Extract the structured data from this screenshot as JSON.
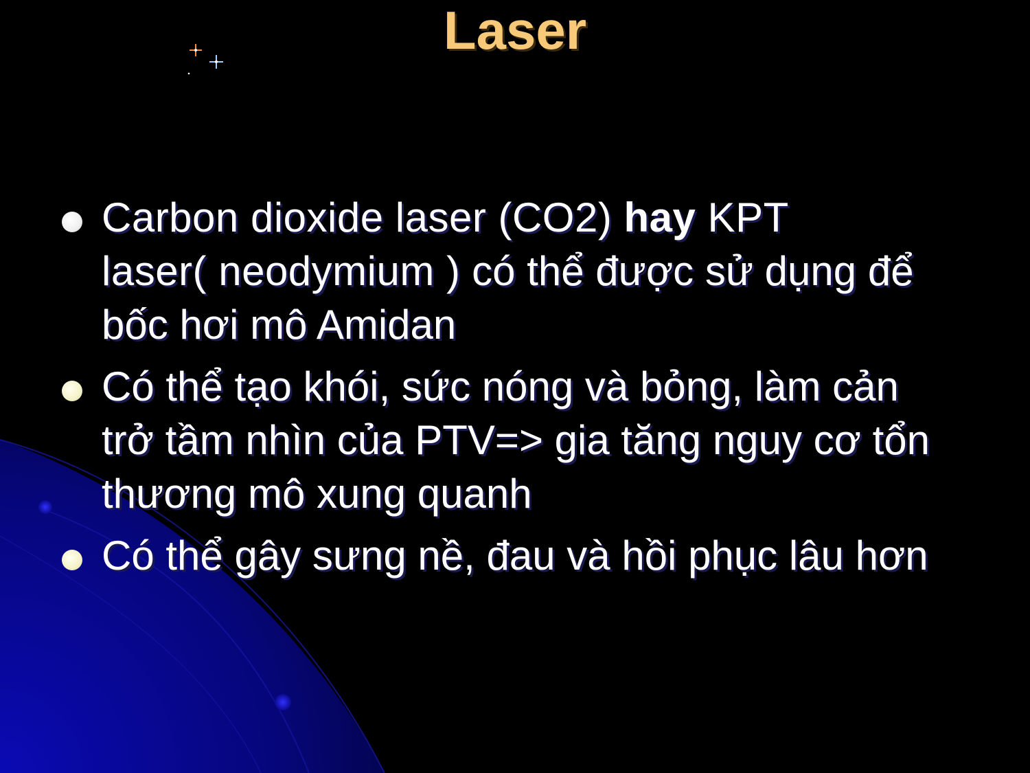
{
  "slide": {
    "title": "Laser",
    "bullets": [
      {
        "line1_a": "Carbon dioxide laser (CO2) ",
        "line1_bold": "hay",
        "line1_b": " KPT",
        "line2_a": "laser( neodymium )",
        "line2_b": " có thể được sử dụng để",
        "line3": "bốc hơi mô Amidan"
      },
      {
        "line1": "Có thể tạo khói, sức nóng và bỏng, làm cản",
        "line2": "trở tầm nhìn của PTV=> gia tăng nguy cơ tổn",
        "line3": "thương mô xung quanh"
      },
      {
        "line1": "Có thể gây sưng nề, đau và hồi phục lâu hơn"
      }
    ]
  },
  "colors": {
    "background": "#000000",
    "title": "#f7c978",
    "text": "#ffffff",
    "accent_blue": "#0a0aa0"
  },
  "icons": {
    "sparkle": "star-sparkle-icon",
    "bullet": "round-bullet-icon"
  }
}
